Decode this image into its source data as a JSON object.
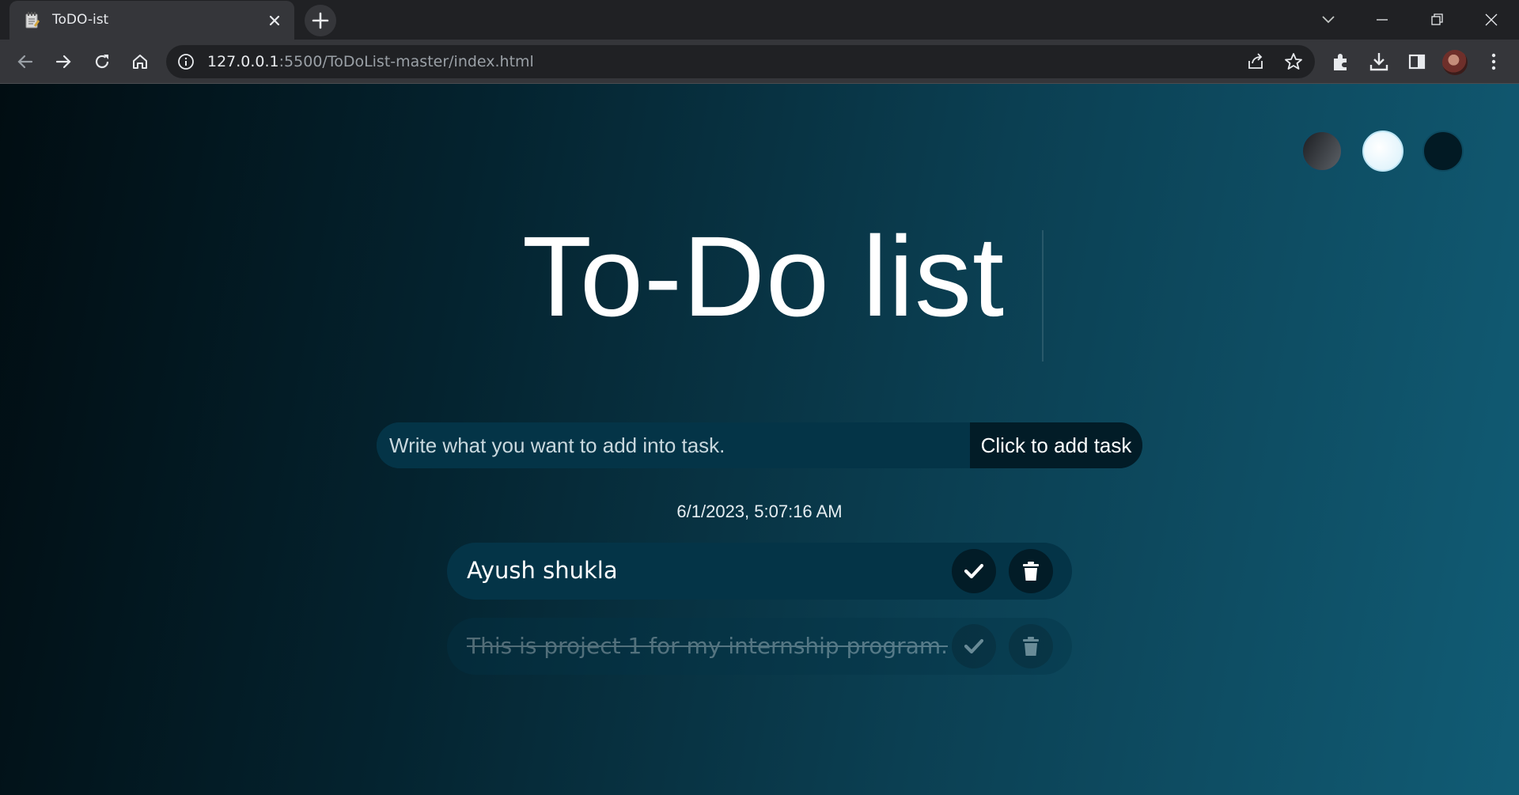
{
  "browser": {
    "tab_title": "ToDO-ist",
    "url_host": "127.0.0.1",
    "url_rest": ":5500/ToDoList-master/index.html"
  },
  "page": {
    "title": "To-Do list",
    "input_placeholder": "Write what you want to add into task.",
    "add_button_label": "Click to add task",
    "datetime": "6/1/2023, 5:07:16 AM",
    "themes": [
      "standard",
      "light",
      "darker"
    ]
  },
  "todos": [
    {
      "text": "Ayush shukla",
      "completed": false
    },
    {
      "text": "This is project 1 for my internship program.",
      "completed": true
    }
  ],
  "icons": {
    "tab_favicon": "notepad-icon",
    "check": "check-icon",
    "delete": "trash-icon"
  }
}
